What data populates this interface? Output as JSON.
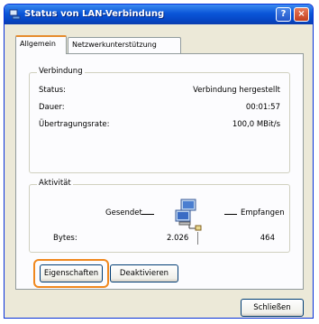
{
  "window": {
    "title": "Status von LAN-Verbindung",
    "help_button": "?",
    "close_button": "×"
  },
  "tabs": [
    {
      "label": "Allgemein",
      "active": true
    },
    {
      "label": "Netzwerkunterstützung",
      "active": false
    }
  ],
  "connection": {
    "group_label": "Verbindung",
    "rows": [
      {
        "label": "Status:",
        "value": "Verbindung hergestellt"
      },
      {
        "label": "Dauer:",
        "value": "00:01:57"
      },
      {
        "label": "Übertragungsrate:",
        "value": "100,0 MBit/s"
      }
    ]
  },
  "activity": {
    "group_label": "Aktivität",
    "sent_label": "Gesendet",
    "received_label": "Empfangen",
    "bytes_label": "Bytes:",
    "bytes_sent": "2.026",
    "bytes_received": "464",
    "icon": "network-computers-icon"
  },
  "buttons": {
    "properties": "Eigenschaften",
    "deactivate": "Deaktivieren",
    "close": "Schließen"
  },
  "colors": {
    "titlebar": "#0a55d8",
    "highlight": "#f0881e",
    "window_bg": "#ece9d8"
  }
}
